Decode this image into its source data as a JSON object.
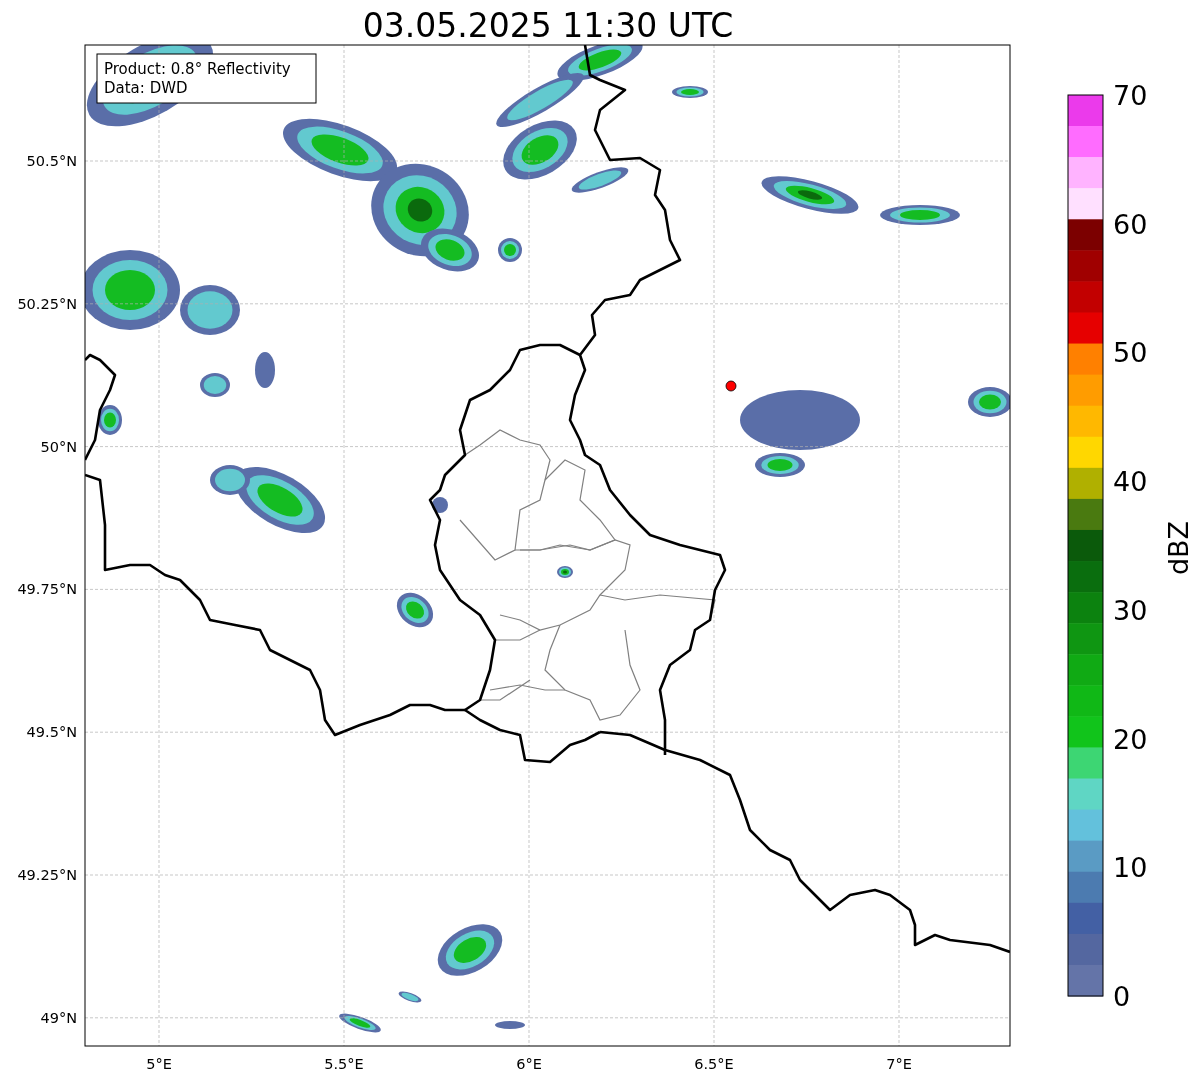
{
  "title": "03.05.2025 11:30 UTC",
  "info_box": [
    "Product: 0.8° Reflectivity",
    "Data: DWD"
  ],
  "x_ticks": [
    "5°E",
    "5.5°E",
    "6°E",
    "6.5°E",
    "7°E"
  ],
  "y_ticks": [
    "50.5°N",
    "50.25°N",
    "50°N",
    "49.75°N",
    "49.5°N",
    "49.25°N",
    "49°N"
  ],
  "colorbar": {
    "label": "dBZ",
    "ticks": [
      "70",
      "60",
      "50",
      "40",
      "30",
      "20",
      "10",
      "0"
    ],
    "segments": [
      {
        "color": "#eb3aeb"
      },
      {
        "color": "#ff6cff"
      },
      {
        "color": "#ffb3ff"
      },
      {
        "color": "#ffe0ff"
      },
      {
        "color": "#7c0000"
      },
      {
        "color": "#a00000"
      },
      {
        "color": "#c20000"
      },
      {
        "color": "#e60000"
      },
      {
        "color": "#ff8000"
      },
      {
        "color": "#ff9c00"
      },
      {
        "color": "#ffb800"
      },
      {
        "color": "#ffd700"
      },
      {
        "color": "#b0b000"
      },
      {
        "color": "#4a7a10"
      },
      {
        "color": "#0b5a0b"
      },
      {
        "color": "#0a6e0e"
      },
      {
        "color": "#0c820f"
      },
      {
        "color": "#0f9612"
      },
      {
        "color": "#10aa14"
      },
      {
        "color": "#10b816"
      },
      {
        "color": "#11c41b"
      },
      {
        "color": "#3dd673"
      },
      {
        "color": "#5fd6c4"
      },
      {
        "color": "#63c1dc"
      },
      {
        "color": "#5a9bc4"
      },
      {
        "color": "#4c7bb0"
      },
      {
        "color": "#4360a4"
      },
      {
        "color": "#5467a0"
      },
      {
        "color": "#6474a8"
      }
    ]
  }
}
